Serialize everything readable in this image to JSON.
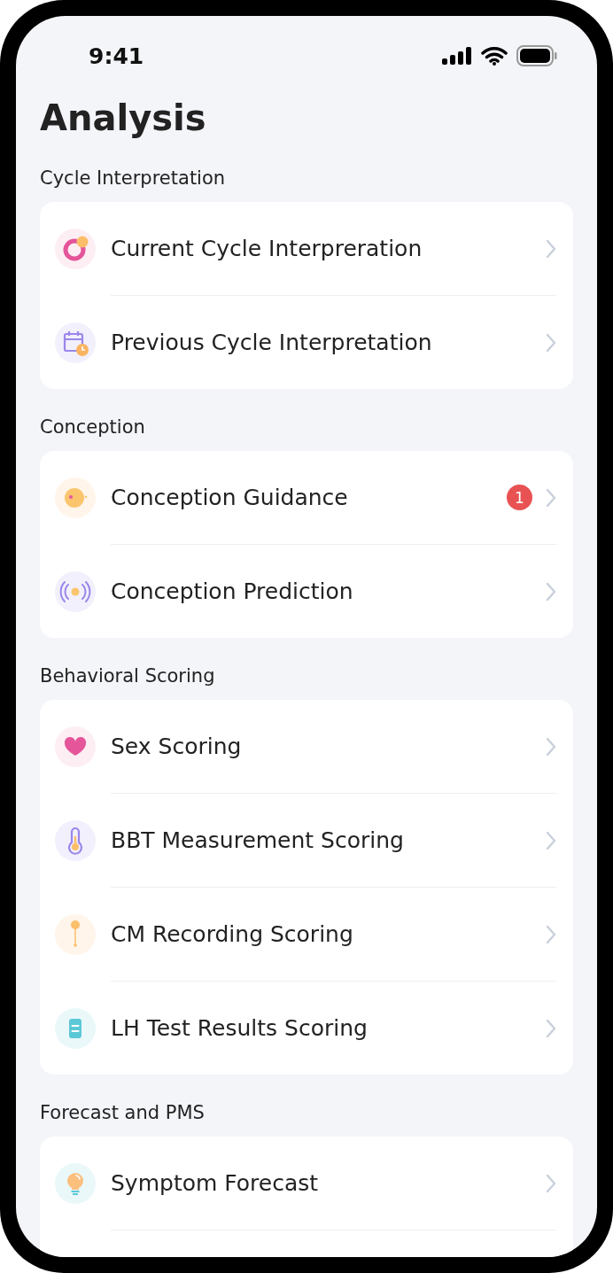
{
  "status_bar": {
    "time": "9:41"
  },
  "title": "Analysis",
  "sections": [
    {
      "title": "Cycle Interpretation",
      "cut_off": false,
      "items": [
        {
          "label": "Current Cycle Interpreration"
        },
        {
          "label": "Previous Cycle Interpretation"
        }
      ]
    },
    {
      "title": "Conception",
      "cut_off": false,
      "items": [
        {
          "label": "Conception Guidance",
          "badge": "1"
        },
        {
          "label": "Conception Prediction"
        }
      ]
    },
    {
      "title": "Behavioral Scoring",
      "cut_off": false,
      "items": [
        {
          "label": "Sex Scoring"
        },
        {
          "label": "BBT Measurement Scoring"
        },
        {
          "label": "CM Recording Scoring"
        },
        {
          "label": "LH Test Results Scoring"
        }
      ]
    },
    {
      "title": "Forecast and PMS",
      "cut_off": true,
      "items": [
        {
          "label": "Symptom Forecast"
        }
      ]
    }
  ]
}
